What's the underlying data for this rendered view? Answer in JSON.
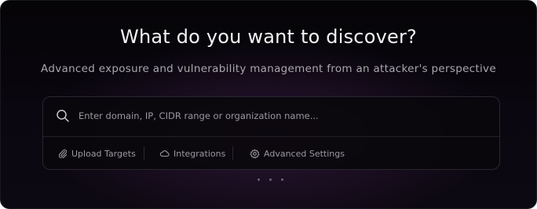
{
  "hero": {
    "title": "What do you want to discover?",
    "subtitle": "Advanced exposure and vulnerability management from an attacker's perspective"
  },
  "search": {
    "placeholder": "Enter domain, IP, CIDR range or organization name...",
    "value": "",
    "icon": "search-icon"
  },
  "actions": [
    {
      "label": "Upload Targets",
      "icon": "paperclip-icon"
    },
    {
      "label": "Integrations",
      "icon": "cloud-icon"
    },
    {
      "label": "Advanced Settings",
      "icon": "gear-icon"
    }
  ],
  "carousel": {
    "dots": 3,
    "active": 0
  },
  "colors": {
    "background": "#08060b",
    "glow": "#462050",
    "text_primary": "#f2f2f4",
    "text_secondary": "#a9a7ad"
  }
}
